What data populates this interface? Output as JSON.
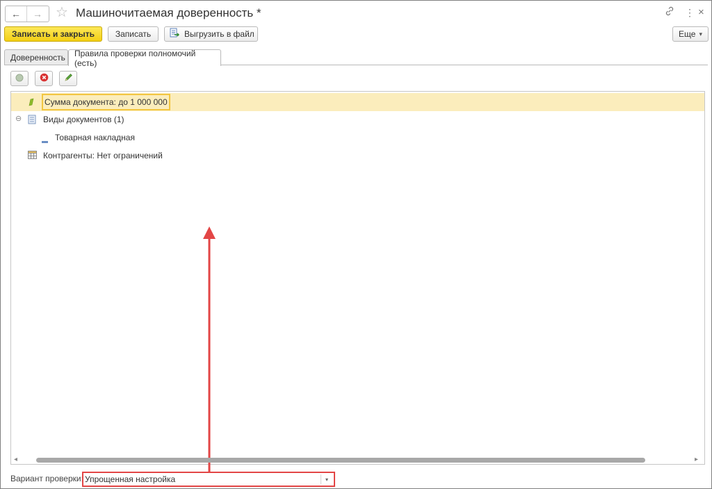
{
  "window": {
    "title": "Машиночитаемая доверенность *",
    "back_glyph": "←",
    "forward_glyph": "→",
    "star_glyph": "☆",
    "link_glyph": "🔗",
    "menu_glyph": "⋮",
    "close_glyph": "×"
  },
  "toolbar": {
    "save_close_label": "Записать и закрыть",
    "save_label": "Записать",
    "export_label": "Выгрузить в файл",
    "more_label": "Еще",
    "more_caret": "▾"
  },
  "tabs": [
    {
      "label": "Доверенность",
      "active": false
    },
    {
      "label": "Правила проверки полномочий (есть)",
      "active": true
    }
  ],
  "actions": {
    "add_icon": "add-icon",
    "delete_icon": "delete-icon",
    "edit_icon": "edit-icon"
  },
  "tree": {
    "rows": [
      {
        "label": "Сумма документа: до 1 000 000",
        "icon": "amount-icon",
        "selected": true
      },
      {
        "label": "Виды документов (1)",
        "icon": "document-list-icon",
        "expander": "⊖"
      },
      {
        "label": "Товарная накладная",
        "icon": "dash-icon",
        "level": 2
      },
      {
        "label": "Контрагенты: Нет ограничений",
        "icon": "table-icon"
      }
    ]
  },
  "scrollbar": {
    "left_arrow": "◂",
    "right_arrow": "▸"
  },
  "check_variant": {
    "label": "Вариант проверки:",
    "value": "Упрощенная настройка",
    "dropdown_glyph": "▾"
  },
  "colors": {
    "primary_button": "#f5d421",
    "selection": "#fbedbc",
    "selection_border": "#f2c641",
    "highlight_red": "#e34646"
  }
}
